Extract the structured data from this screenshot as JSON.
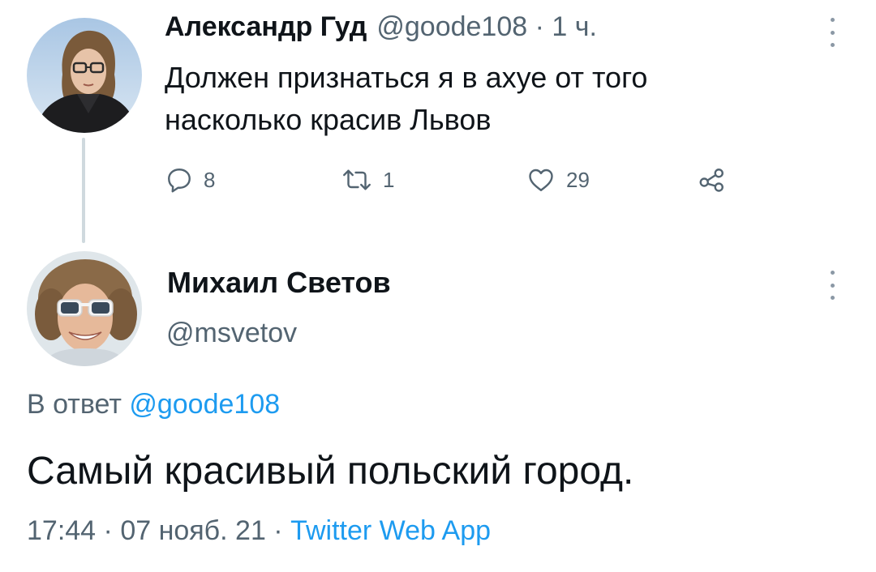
{
  "tweet1": {
    "author_name": "Александр Гуд",
    "handle": "@goode108",
    "separator": " · ",
    "time_ago": "1 ч.",
    "text": "Должен признаться я в ахуе от того насколько красив Львов",
    "replies": "8",
    "retweets": "1",
    "likes": "29"
  },
  "tweet2": {
    "author_name": "Михаил Светов",
    "handle": "@msvetov",
    "reply_prefix": "В ответ ",
    "reply_to_handle": "@goode108",
    "text": "Самый красивый польский город.",
    "time": "17:44",
    "separator1": " · ",
    "date": "07 нояб. 21",
    "separator2": " · ",
    "source": "Twitter Web App"
  },
  "icons": {
    "reply": "reply-icon",
    "retweet": "retweet-icon",
    "like": "heart-icon",
    "share": "share-icon",
    "more": "more-vertical-icon"
  },
  "colors": {
    "text": "#0f1419",
    "muted": "#536471",
    "link": "#1d9bf0",
    "thread_line": "#cfd9de"
  }
}
